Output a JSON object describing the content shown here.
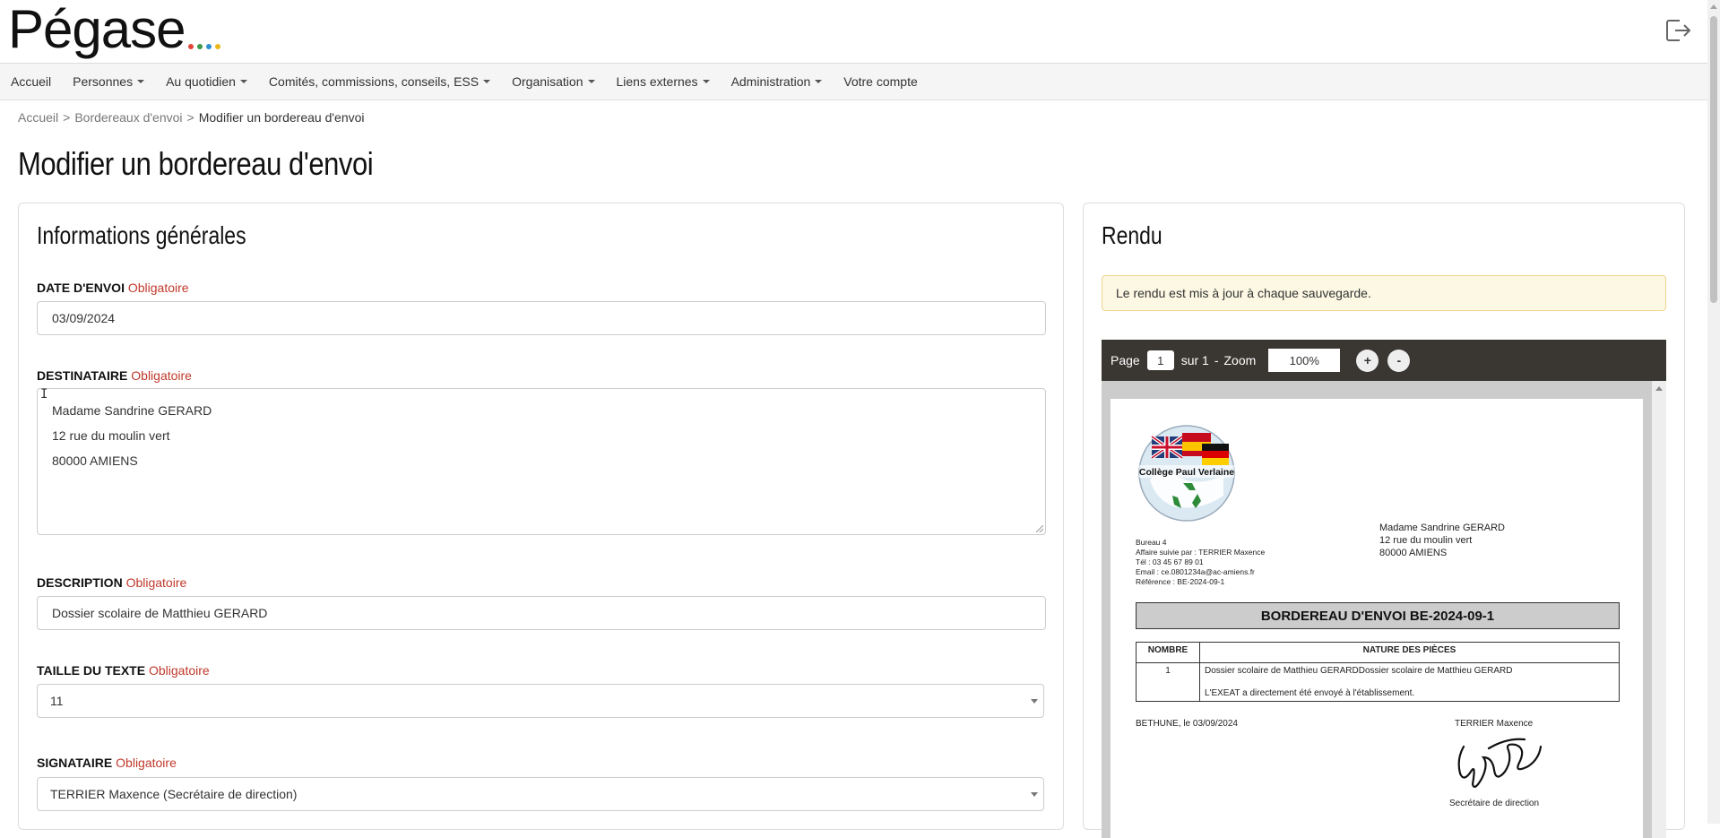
{
  "app": {
    "logo_text": "Pégase",
    "logo_dot_colors": [
      "#e0453a",
      "#3b9a4a",
      "#2f8fcf",
      "#e9b91b"
    ]
  },
  "icons": {
    "logout": "logout-icon"
  },
  "nav": {
    "items": [
      {
        "label": "Accueil",
        "dropdown": false
      },
      {
        "label": "Personnes",
        "dropdown": true
      },
      {
        "label": "Au quotidien",
        "dropdown": true
      },
      {
        "label": "Comités, commissions, conseils, ESS",
        "dropdown": true
      },
      {
        "label": "Organisation",
        "dropdown": true
      },
      {
        "label": "Liens externes",
        "dropdown": true
      },
      {
        "label": "Administration",
        "dropdown": true
      },
      {
        "label": "Votre compte",
        "dropdown": false
      }
    ]
  },
  "breadcrumb": {
    "home": "Accueil",
    "list": "Bordereaux d'envoi",
    "current": "Modifier un bordereau d'envoi",
    "sep": ">"
  },
  "page": {
    "title": "Modifier un bordereau d'envoi"
  },
  "form": {
    "panel_title": "Informations générales",
    "required_label": "Obligatoire",
    "date": {
      "label": "DATE D'ENVOI",
      "value": "03/09/2024"
    },
    "recipient": {
      "label": "DESTINATAIRE",
      "lines": [
        "Madame Sandrine GERARD",
        "12 rue du moulin vert",
        "80000 AMIENS"
      ]
    },
    "description": {
      "label": "DESCRIPTION",
      "value": "Dossier scolaire de Matthieu GERARD"
    },
    "text_size": {
      "label": "TAILLE DU TEXTE",
      "value": "11"
    },
    "signatory": {
      "label": "SIGNATAIRE",
      "value": "TERRIER Maxence (Secrétaire de direction)"
    }
  },
  "render": {
    "panel_title": "Rendu",
    "alert": "Le rendu est mis à jour à chaque sauvegarde.",
    "toolbar": {
      "page_label": "Page",
      "page": "1",
      "of_label": "sur 1",
      "dash": "-",
      "zoom_label": "Zoom",
      "zoom": "100%",
      "plus": "+",
      "minus": "-"
    },
    "doc": {
      "logo_text": "Collège Paul Verlaine",
      "address": [
        "Madame Sandrine GERARD",
        "12 rue du moulin vert",
        "80000 AMIENS"
      ],
      "info": [
        "Bureau 4",
        "Affaire suivie par : TERRIER Maxence",
        "Tél : 03 45 67 89 01",
        "Email : ce.0801234a@ac-amiens.fr",
        "Référence : BE-2024-09-1"
      ],
      "title": "BORDEREAU D'ENVOI BE-2024-09-1",
      "col_count": "NOMBRE",
      "col_nature": "NATURE DES PIÈCES",
      "row_count": "1",
      "row_desc": "Dossier scolaire de Matthieu GERARDDossier scolaire de Matthieu GERARD",
      "row_note": "L'EXEAT a directement été envoyé à l'établissement.",
      "city_date": "BETHUNE, le 03/09/2024",
      "signer": "TERRIER Maxence",
      "signer_role": "Secrétaire de direction"
    }
  }
}
